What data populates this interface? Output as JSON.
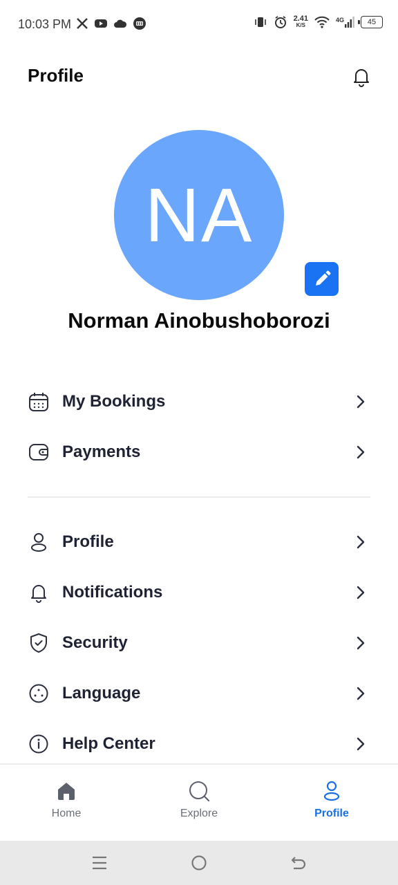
{
  "status_bar": {
    "time": "10:03 PM",
    "network_speed_value": "2.41",
    "network_speed_unit": "K/S",
    "network_type": "4G",
    "battery_level": "45"
  },
  "header": {
    "title": "Profile"
  },
  "profile": {
    "initials": "NA",
    "name": "Norman Ainobushoborozi",
    "avatar_color": "#6aa6fb",
    "edit_button_color": "#1a73f3"
  },
  "menu": {
    "group1": [
      {
        "label": "My Bookings",
        "icon": "calendar-icon"
      },
      {
        "label": "Payments",
        "icon": "wallet-icon"
      }
    ],
    "group2": [
      {
        "label": "Profile",
        "icon": "user-icon"
      },
      {
        "label": "Notifications",
        "icon": "bell-icon"
      },
      {
        "label": "Security",
        "icon": "shield-icon"
      },
      {
        "label": "Language",
        "icon": "language-icon"
      },
      {
        "label": "Help Center",
        "icon": "info-icon"
      }
    ]
  },
  "bottom_nav": {
    "items": [
      {
        "label": "Home",
        "icon": "home-icon"
      },
      {
        "label": "Explore",
        "icon": "search-icon"
      },
      {
        "label": "Profile",
        "icon": "user-icon",
        "active": true
      }
    ],
    "active_color": "#1a6fe8"
  }
}
